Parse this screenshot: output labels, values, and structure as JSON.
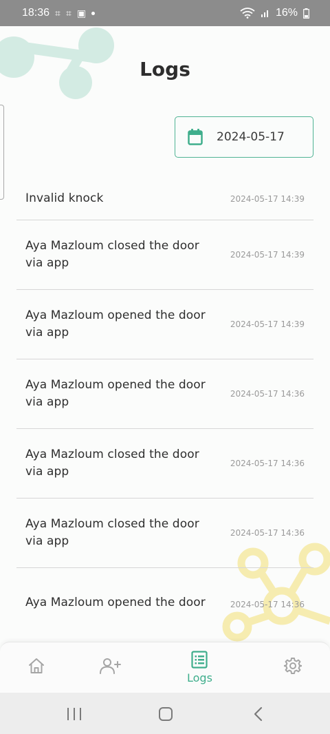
{
  "status_bar": {
    "time": "18:36",
    "battery": "16%"
  },
  "page": {
    "title": "Logs"
  },
  "date_filter": {
    "value": "2024-05-17"
  },
  "logs": [
    {
      "message": "Invalid knock",
      "timestamp": "2024-05-17 14:39"
    },
    {
      "message": "Aya Mazloum closed the door via app",
      "timestamp": "2024-05-17 14:39"
    },
    {
      "message": "Aya Mazloum opened the door via app",
      "timestamp": "2024-05-17 14:39"
    },
    {
      "message": "Aya Mazloum opened the door via app",
      "timestamp": "2024-05-17 14:36"
    },
    {
      "message": "Aya Mazloum closed the door via app",
      "timestamp": "2024-05-17 14:36"
    },
    {
      "message": "Aya Mazloum closed the door via app",
      "timestamp": "2024-05-17 14:36"
    },
    {
      "message": "Aya Mazloum opened the door",
      "timestamp": "2024-05-17 14:36"
    }
  ],
  "bottom_nav": {
    "items": [
      {
        "icon": "home-icon"
      },
      {
        "icon": "add-user-icon"
      },
      {
        "icon": "logs-list-icon",
        "label": "Logs",
        "active": true
      },
      {
        "icon": "gear-icon"
      }
    ]
  },
  "colors": {
    "accent": "#3fae8c",
    "inactive_icon": "#a5a5a5",
    "status_bar": "#8c8c8c",
    "deco_teal": "#cfe9e1",
    "deco_yellow": "#f8efb8"
  }
}
